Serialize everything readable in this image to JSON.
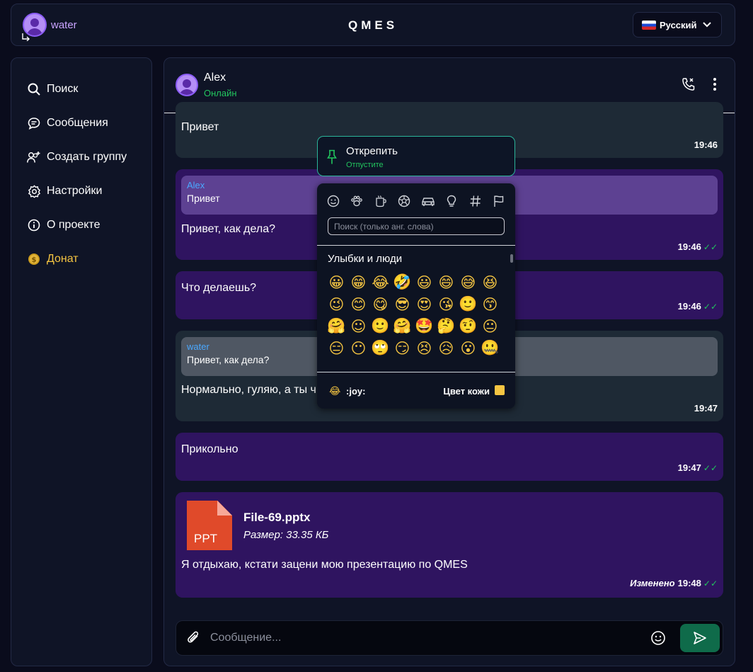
{
  "header": {
    "username": "water",
    "logo": "QMES",
    "language": "Русский"
  },
  "sidebar": {
    "items": [
      {
        "label": "Поиск",
        "icon": "search-icon"
      },
      {
        "label": "Сообщения",
        "icon": "chat-bubble-icon"
      },
      {
        "label": "Создать группу",
        "icon": "add-group-icon"
      },
      {
        "label": "Настройки",
        "icon": "gear-icon"
      },
      {
        "label": "О проекте",
        "icon": "info-icon"
      },
      {
        "label": "Донат",
        "icon": "coin-icon"
      }
    ]
  },
  "chat": {
    "contact_name": "Alex",
    "contact_status": "Онлайн",
    "messages": [
      {
        "text": "Привет",
        "time": "19:46"
      },
      {
        "quote_author": "Alex",
        "quote_text": "Привет",
        "text": "Привет, как дела?",
        "time": "19:46"
      },
      {
        "text": "Что делаешь?",
        "time": "19:46"
      },
      {
        "quote_author": "water",
        "quote_text": "Привет, как дела?",
        "text": "Нормально, гуляю, а ты ч",
        "time": "19:47"
      },
      {
        "text": "Прикольно",
        "time": "19:47"
      },
      {
        "file_type": "PPT",
        "file_name": "File-69.pptx",
        "file_size": "Размер: 33.35 КБ",
        "text": "Я отдыхаю, кстати зацени мою презентацию по QMES",
        "edited": "Изменено",
        "time": "19:48"
      }
    ],
    "composer_placeholder": "Сообщение..."
  },
  "context_menu": {
    "title": "Открепить",
    "subtitle": "Отпустите"
  },
  "emoji_picker": {
    "categories": [
      "smiley-icon",
      "paw-icon",
      "cup-icon",
      "ball-icon",
      "car-icon",
      "bulb-icon",
      "hash-icon",
      "flag-icon"
    ],
    "search_placeholder": "Поиск (только анг. слова)",
    "section_title": "Улыбки и люди",
    "emojis": [
      "😀",
      "😁",
      "😂",
      "🤣",
      "😃",
      "😄",
      "😅",
      "😆",
      "😉",
      "😊",
      "😋",
      "😎",
      "😍",
      "😘",
      "🙂",
      "😙",
      "🤗",
      "☺",
      "🙂",
      "🤗",
      "🤩",
      "🤔",
      "🤨",
      "😐",
      "😑",
      "😶",
      "🙄",
      "😏",
      "😣",
      "😥",
      "😮",
      "🤐"
    ],
    "footer_emoji": "😂",
    "footer_code": ":joy:",
    "skin_label": "Цвет кожи"
  },
  "colors": {
    "accent_green": "#22c55e",
    "outgoing_bubble": "#2f1460",
    "incoming_bubble": "#1e2a36",
    "donate": "#f5c542"
  }
}
